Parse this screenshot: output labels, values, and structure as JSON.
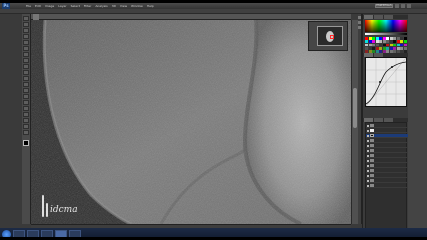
{
  "app": {
    "logo": "Ps",
    "document_tab": "",
    "workspace_label": "ESSENTIALS"
  },
  "menubar": {
    "items": [
      "File",
      "Edit",
      "Image",
      "Layer",
      "Select",
      "Filter",
      "Analysis",
      "3D",
      "View",
      "Window",
      "Help"
    ]
  },
  "toolbox": {
    "tools": [
      "move-tool",
      "marquee-tool",
      "lasso-tool",
      "quick-select-tool",
      "crop-tool",
      "eyedropper-tool",
      "healing-brush-tool",
      "brush-tool",
      "clone-stamp-tool",
      "history-brush-tool",
      "eraser-tool",
      "gradient-tool",
      "blur-tool",
      "dodge-tool",
      "pen-tool",
      "type-tool",
      "path-select-tool",
      "shape-tool",
      "hand-tool",
      "zoom-tool"
    ]
  },
  "watermark": {
    "text": "idcma"
  },
  "panels": {
    "curves_label": "",
    "layers": [
      {
        "name": "",
        "thumb": "normal"
      },
      {
        "name": "",
        "thumb": "white"
      },
      {
        "name": "",
        "thumb": "dark",
        "selected": true
      },
      {
        "name": "",
        "thumb": "normal"
      },
      {
        "name": "",
        "thumb": "normal"
      },
      {
        "name": "",
        "thumb": "normal"
      },
      {
        "name": "",
        "thumb": "normal"
      },
      {
        "name": "",
        "thumb": "normal"
      },
      {
        "name": "",
        "thumb": "normal"
      },
      {
        "name": "",
        "thumb": "normal"
      },
      {
        "name": "",
        "thumb": "normal"
      },
      {
        "name": "",
        "thumb": "normal"
      },
      {
        "name": "",
        "thumb": "normal"
      }
    ]
  },
  "taskbar": {
    "clock": ""
  },
  "colors": {
    "selected_layer": "#1c3b78",
    "navigator_view_box": "#ff2a2a"
  }
}
